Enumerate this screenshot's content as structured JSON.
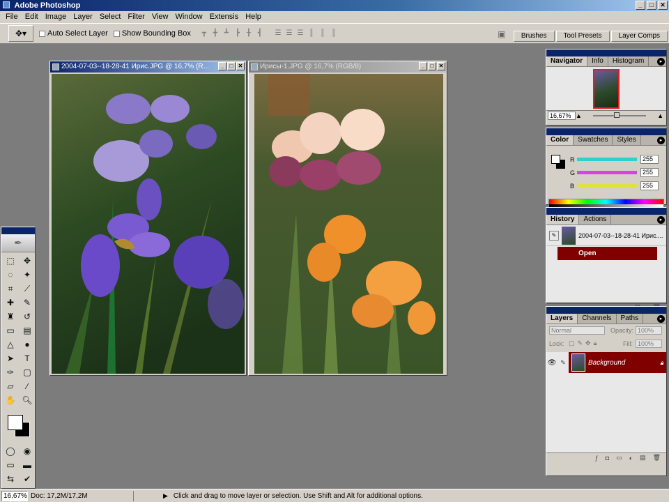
{
  "app": {
    "title": "Adobe Photoshop",
    "icon": "photoshop-icon"
  },
  "window_buttons": [
    "_",
    "□",
    "✕"
  ],
  "menus": [
    "File",
    "Edit",
    "Image",
    "Layer",
    "Select",
    "Filter",
    "View",
    "Window",
    "Extensis",
    "Help"
  ],
  "options": {
    "auto_select": "Auto Select Layer",
    "bounding_box": "Show Bounding Box"
  },
  "well_tabs": [
    "Brushes",
    "Tool Presets",
    "Layer Comps"
  ],
  "documents": [
    {
      "title": "2004-07-03--18-28-41 Ирис.JPG @ 16,7% (R..."
    },
    {
      "title": "Ирисы-1.JPG @ 16,7% (RGB/8)"
    }
  ],
  "navigator": {
    "tabs": [
      "Navigator",
      "Info",
      "Histogram"
    ],
    "zoom": "16,67%"
  },
  "color": {
    "tabs": [
      "Color",
      "Swatches",
      "Styles"
    ],
    "channels": [
      {
        "label": "R",
        "value": "255",
        "bar": "#30d0d0"
      },
      {
        "label": "G",
        "value": "255",
        "bar": "#e040e0"
      },
      {
        "label": "B",
        "value": "255",
        "bar": "#e0e040"
      }
    ]
  },
  "history": {
    "tabs": [
      "History",
      "Actions"
    ],
    "snapshot": "2004-07-03--18-28-41 Ирис....",
    "step": "Open"
  },
  "layers": {
    "tabs": [
      "Layers",
      "Channels",
      "Paths"
    ],
    "blend": "Normal",
    "opacity_label": "Opacity:",
    "opacity": "100%",
    "lock_label": "Lock:",
    "fill_label": "Fill:",
    "fill": "100%",
    "layer_name": "Background"
  },
  "status": {
    "zoom": "16,67%",
    "doc": "Doc: 17,2M/17,2M",
    "hint": "Click and drag to move layer or selection.  Use Shift and Alt for additional options."
  },
  "colors": {
    "titlebar": "#0a246a",
    "chrome": "#d4d0c8",
    "selection": "#800000"
  }
}
